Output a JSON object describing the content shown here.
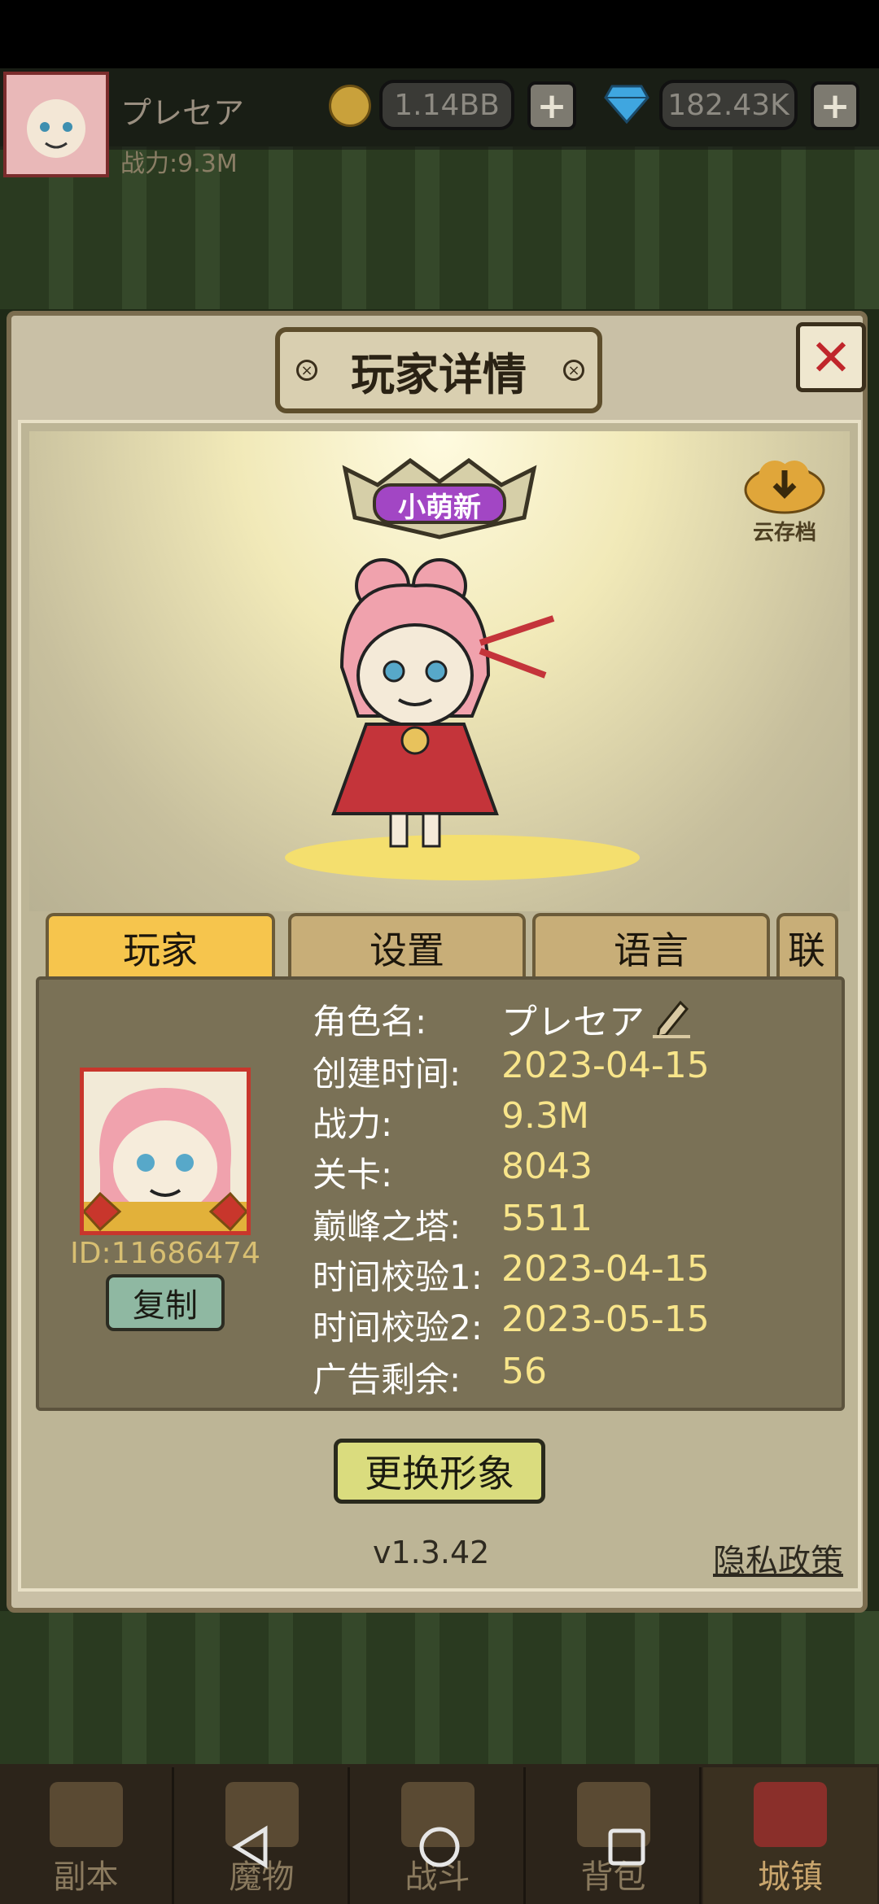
{
  "hud": {
    "player_name": "プレセア",
    "power_text": "战力:9.3M",
    "gold": "1.14BB",
    "gems": "182.43K",
    "plus_label": "+"
  },
  "dialog": {
    "title": "玩家详情",
    "close_label": "✕",
    "rank_badge": "小萌新",
    "cloud_save_label": "云存档",
    "tabs": [
      "玩家",
      "设置",
      "语言",
      "联"
    ],
    "player_id": "ID:11686474",
    "copy_label": "复制",
    "info": [
      {
        "label": "角色名:",
        "value": "プレセア"
      },
      {
        "label": "创建时间:",
        "value": "2023-04-15"
      },
      {
        "label": "战力:",
        "value": "9.3M"
      },
      {
        "label": "关卡:",
        "value": "8043"
      },
      {
        "label": "巅峰之塔:",
        "value": "5511"
      },
      {
        "label": "时间校验1:",
        "value": "2023-04-15"
      },
      {
        "label": "时间校验2:",
        "value": "2023-05-15"
      },
      {
        "label": "广告剩余:",
        "value": "56"
      }
    ],
    "change_avatar_label": "更换形象",
    "version": "v1.3.42",
    "privacy_label": "隐私政策"
  },
  "bottom_nav": [
    "副本",
    "魔物",
    "战斗",
    "背包",
    "城镇"
  ],
  "colors": {
    "accent": "#f6c54d",
    "value_text": "#f8e58a",
    "close_red": "#c0262b"
  }
}
